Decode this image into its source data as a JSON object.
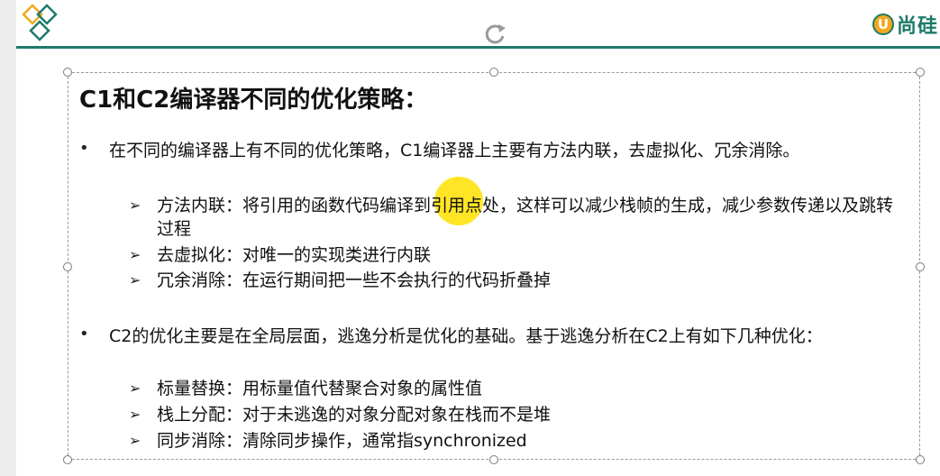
{
  "brand": {
    "mark": "U",
    "text": "尚硅"
  },
  "title": "C1和C2编译器不同的优化策略：",
  "bullets": [
    {
      "text": "在不同的编译器上有不同的优化策略，C1编译器上主要有方法内联，去虚拟化、冗余消除。",
      "items": [
        "方法内联：将引用的函数代码编译到引用点处，这样可以减少栈帧的生成，减少参数传递以及跳转过程",
        "去虚拟化：对唯一的实现类进行内联",
        "冗余消除：在运行期间把一些不会执行的代码折叠掉"
      ]
    },
    {
      "text": "C2的优化主要是在全局层面，逃逸分析是优化的基础。基于逃逸分析在C2上有如下几种优化：",
      "items": [
        "标量替换：用标量值代替聚合对象的属性值",
        "栈上分配：对于未逃逸的对象分配对象在栈而不是堆",
        "同步消除：清除同步操作，通常指synchronized"
      ]
    }
  ],
  "colors": {
    "accent": "#1d7a6c",
    "brand_orange": "#f2a81d",
    "highlight": "#ffe000"
  },
  "icons": {
    "bullet": "bullet-dot",
    "sub_bullet": "arrow-right"
  }
}
